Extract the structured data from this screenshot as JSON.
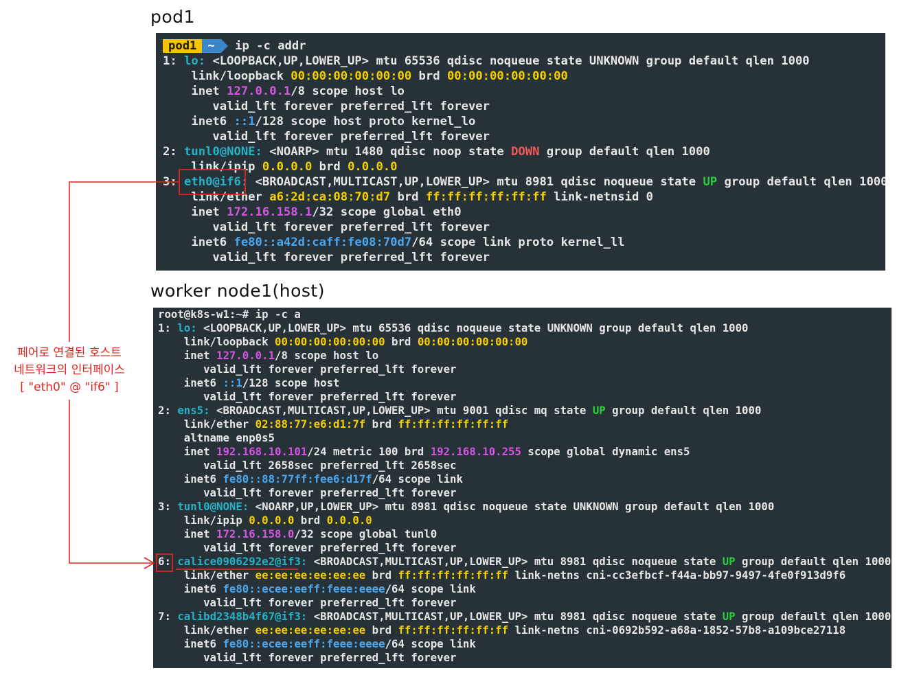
{
  "headings": {
    "pod": "pod1",
    "host": "worker node1(host)"
  },
  "annotation": {
    "line1": "페어로 연결된 호스트",
    "line2": "네트워크의 인터페이스",
    "line3": "[ \"eth0\" @ \"if6\" ]"
  },
  "pod_terminal": {
    "prompt_name": "pod1",
    "prompt_dir": "~",
    "command": "ip -c addr",
    "l1_idx": "1: ",
    "l1_if": "lo:",
    "l1_rest": " <LOOPBACK,UP,LOWER_UP> mtu 65536 qdisc noqueue state UNKNOWN group default qlen 1000",
    "l2_a": "    link/loopback ",
    "l2_mac": "00:00:00:00:00:00",
    "l2_b": " brd ",
    "l2_brd": "00:00:00:00:00:00",
    "l3_a": "    inet ",
    "l3_ip": "127.0.0.1",
    "l3_b": "/8 scope host lo",
    "l4": "       valid_lft forever preferred_lft forever",
    "l5_a": "    inet6 ",
    "l5_ip": "::1",
    "l5_b": "/128 scope host proto kernel_lo",
    "l6": "       valid_lft forever preferred_lft forever",
    "l7_idx": "2: ",
    "l7_if": "tunl0@NONE:",
    "l7_a": " <NOARP> mtu 1480 qdisc noop state ",
    "l7_state": "DOWN",
    "l7_b": " group default qlen 1000",
    "l8_a": "    link/ipip ",
    "l8_ip": "0.0.0.0",
    "l8_b": " brd ",
    "l8_brd": "0.0.0.0",
    "l9_idx": "3: ",
    "l9_if": "eth0@if6:",
    "l9_a": " <BROADCAST,MULTICAST,UP,LOWER_UP> mtu 8981 qdisc noqueue state ",
    "l9_state": "UP",
    "l9_b": " group default qlen 1000",
    "l10_a": "    link/ether ",
    "l10_mac": "a6:2d:ca:08:70:d7",
    "l10_b": " brd ",
    "l10_brd": "ff:ff:ff:ff:ff:ff",
    "l10_c": " link-netnsid 0",
    "l11_a": "    inet ",
    "l11_ip": "172.16.158.1",
    "l11_b": "/32 scope global eth0",
    "l12": "       valid_lft forever preferred_lft forever",
    "l13_a": "    inet6 ",
    "l13_ip": "fe80::a42d:caff:fe08:70d7",
    "l13_b": "/64 scope link proto kernel_ll",
    "l14": "       valid_lft forever preferred_lft forever"
  },
  "host_terminal": {
    "prompt": "root@k8s-w1:~# ip -c a",
    "h1_idx": "1: ",
    "h1_if": "lo:",
    "h1_rest": " <LOOPBACK,UP,LOWER_UP> mtu 65536 qdisc noqueue state UNKNOWN group default qlen 1000",
    "h2_a": "    link/loopback ",
    "h2_mac": "00:00:00:00:00:00",
    "h2_b": " brd ",
    "h2_brd": "00:00:00:00:00:00",
    "h3_a": "    inet ",
    "h3_ip": "127.0.0.1",
    "h3_b": "/8 scope host lo",
    "h4": "       valid_lft forever preferred_lft forever",
    "h5_a": "    inet6 ",
    "h5_ip": "::1",
    "h5_b": "/128 scope host",
    "h6": "       valid_lft forever preferred_lft forever",
    "h7_idx": "2: ",
    "h7_if": "ens5:",
    "h7_a": " <BROADCAST,MULTICAST,UP,LOWER_UP> mtu 9001 qdisc mq state ",
    "h7_state": "UP",
    "h7_b": " group default qlen 1000",
    "h8_a": "    link/ether ",
    "h8_mac": "02:88:77:e6:d1:7f",
    "h8_b": " brd ",
    "h8_brd": "ff:ff:ff:ff:ff:ff",
    "h9": "    altname enp0s5",
    "h10_a": "    inet ",
    "h10_ip": "192.168.10.101",
    "h10_b": "/24 metric 100 brd ",
    "h10_brd": "192.168.10.255",
    "h10_c": " scope global dynamic ens5",
    "h11": "       valid_lft 2658sec preferred_lft 2658sec",
    "h12_a": "    inet6 ",
    "h12_ip": "fe80::88:77ff:fee6:d17f",
    "h12_b": "/64 scope link",
    "h13": "       valid_lft forever preferred_lft forever",
    "h14_idx": "3: ",
    "h14_if": "tunl0@NONE:",
    "h14_rest": " <NOARP,UP,LOWER_UP> mtu 8981 qdisc noqueue state UNKNOWN group default qlen 1000",
    "h15_a": "    link/ipip ",
    "h15_ip": "0.0.0.0",
    "h15_b": " brd ",
    "h15_brd": "0.0.0.0",
    "h16_a": "    inet ",
    "h16_ip": "172.16.158.0",
    "h16_b": "/32 scope global tunl0",
    "h17": "       valid_lft forever preferred_lft forever",
    "h18_idx": "6:",
    "h18_sp": " ",
    "h18_if": "calice0906292e2@if3:",
    "h18_a": " <BROADCAST,MULTICAST,UP,LOWER_UP> mtu 8981 qdisc noqueue state ",
    "h18_state": "UP",
    "h18_b": " group default qlen 1000",
    "h19_a": "    link/ether ",
    "h19_mac": "ee:ee:ee:ee:ee:ee",
    "h19_b": " brd ",
    "h19_brd": "ff:ff:ff:ff:ff:ff",
    "h19_c": " link-netns cni-cc3efbcf-f44a-bb97-9497-4fe0f913d9f6",
    "h20_a": "    inet6 ",
    "h20_ip": "fe80::ecee:eeff:feee:eeee",
    "h20_b": "/64 scope link",
    "h21": "       valid_lft forever preferred_lft forever",
    "h22_idx": "7: ",
    "h22_if": "calibd2348b4f67@if3:",
    "h22_a": " <BROADCAST,MULTICAST,UP,LOWER_UP> mtu 8981 qdisc noqueue state ",
    "h22_state": "UP",
    "h22_b": " group default qlen 1000",
    "h23_a": "    link/ether ",
    "h23_mac": "ee:ee:ee:ee:ee:ee",
    "h23_b": " brd ",
    "h23_brd": "ff:ff:ff:ff:ff:ff",
    "h23_c": " link-netns cni-0692b592-a68a-1852-57b8-a109bce27118",
    "h24_a": "    inet6 ",
    "h24_ip": "fe80::ecee:eeff:feee:eeee",
    "h24_b": "/64 scope link",
    "h25": "       valid_lft forever preferred_lft forever"
  },
  "colors": {
    "terminal_bg": "#263238",
    "interface": "#26b1c7",
    "mac": "#f5d000",
    "ipv4": "#d455e0",
    "ipv6": "#4aa8f0",
    "state_up": "#2ecc40",
    "state_down": "#f05a5a",
    "annotation": "#e0251c"
  }
}
